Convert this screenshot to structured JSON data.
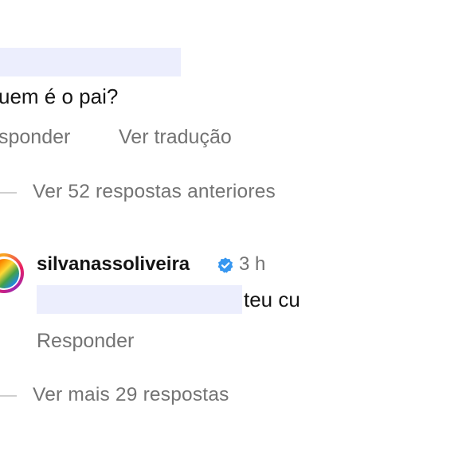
{
  "parent_comment": {
    "text": "uem é o pai?",
    "actions": {
      "reply_label": "sponder",
      "translate_label": "Ver tradução"
    }
  },
  "view_previous": {
    "label": "Ver 52 respostas anteriores"
  },
  "reply_comment": {
    "username": "silvanassoliveira",
    "time": "3 h",
    "text": "teu cu",
    "reply_label": "Responder",
    "verified_icon": "verified-badge-icon"
  },
  "view_more": {
    "label": "Ver mais 29 respostas"
  },
  "colors": {
    "secondary_text": "#737373",
    "verified_blue": "#3797f0",
    "redaction": "#eceefd"
  }
}
